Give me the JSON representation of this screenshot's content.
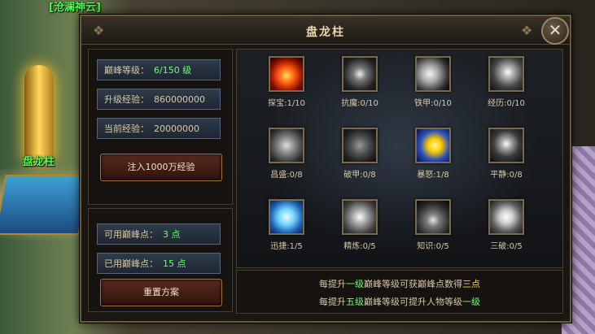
{
  "world": {
    "top_label_1": "[沧澜神云]",
    "totem_label": "盘龙柱"
  },
  "panel": {
    "title": "盘龙柱",
    "stats": {
      "peak_level_label": "巅峰等级：",
      "peak_level_value": "6/150 级",
      "upgrade_exp_label": "升级经验：",
      "upgrade_exp_value": "860000000",
      "current_exp_label": "当前经验：",
      "current_exp_value": "20000000"
    },
    "inject_button": "注入1000万经验",
    "points": {
      "available_label": "可用巅峰点：",
      "available_value": "3 点",
      "used_label": "已用巅峰点：",
      "used_value": "15 点"
    },
    "reset_button": "重置方案",
    "skills": [
      {
        "name": "探宝",
        "count": "1/10",
        "icon": "fire-orb-icon"
      },
      {
        "name": "抗魔",
        "count": "0/10",
        "icon": "dark-smoke-icon"
      },
      {
        "name": "铁甲",
        "count": "0/10",
        "icon": "claw-slash-icon"
      },
      {
        "name": "经历",
        "count": "0/10",
        "icon": "whirlwind-icon"
      },
      {
        "name": "昌盛",
        "count": "0/8",
        "icon": "mist-icon"
      },
      {
        "name": "破甲",
        "count": "0/8",
        "icon": "beast-icon"
      },
      {
        "name": "暴怒",
        "count": "1/8",
        "icon": "thunder-icon"
      },
      {
        "name": "平静",
        "count": "0/8",
        "icon": "figure-icon"
      },
      {
        "name": "迅捷",
        "count": "1/5",
        "icon": "ice-crystal-icon"
      },
      {
        "name": "精炼",
        "count": "0/5",
        "icon": "dragon-icon"
      },
      {
        "name": "知识",
        "count": "0/5",
        "icon": "swords-icon"
      },
      {
        "name": "三破",
        "count": "0/5",
        "icon": "lightning-icon"
      }
    ],
    "info": {
      "line1_a": "每提升",
      "line1_b": "一级",
      "line1_c": "巅峰等级可获巅峰点数得",
      "line1_d": "三点",
      "line2_a": "每提升",
      "line2_b": "五级",
      "line2_c": "巅峰等级可提升人物等级",
      "line2_d": "一级"
    }
  }
}
